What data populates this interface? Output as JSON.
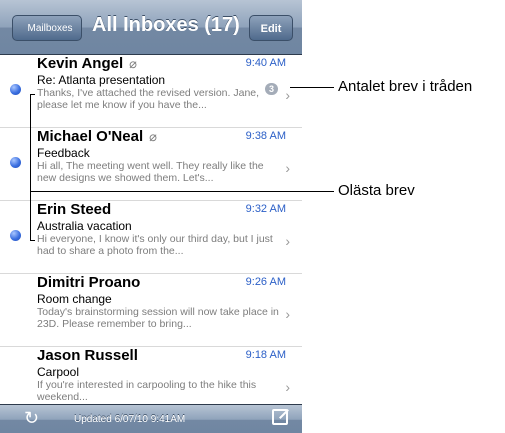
{
  "navbar": {
    "back_label": "Mailboxes",
    "title": "All Inboxes (17)",
    "edit_label": "Edit"
  },
  "messages": [
    {
      "sender": "Kevin Angel",
      "attachment": true,
      "time": "9:40 AM",
      "subject": "Re: Atlanta presentation",
      "preview": "Thanks, I've attached the revised version. Jane, please let me know if you have the...",
      "unread": true,
      "thread_count": "3"
    },
    {
      "sender": "Michael O'Neal",
      "attachment": true,
      "time": "9:38 AM",
      "subject": "Feedback",
      "preview": "Hi all, The meeting went well. They really like the new designs we showed them. Let's...",
      "unread": true
    },
    {
      "sender": "Erin Steed",
      "attachment": false,
      "time": "9:32 AM",
      "subject": "Australia vacation",
      "preview": "Hi everyone, I know it's only our third day, but I just had to share a photo from the...",
      "unread": true
    },
    {
      "sender": "Dimitri Proano",
      "attachment": false,
      "time": "9:26 AM",
      "subject": "Room change",
      "preview": "Today's brainstorming session will now take place in 23D. Please remember to bring...",
      "unread": false
    },
    {
      "sender": "Jason Russell",
      "attachment": false,
      "time": "9:18 AM",
      "subject": "Carpool",
      "preview": "If you're interested in carpooling to the hike this weekend...",
      "unread": false
    }
  ],
  "icons": {
    "attachment": "paperclip-icon",
    "disclosure": "chevron-right-icon",
    "refresh": "refresh-icon",
    "compose": "compose-icon",
    "unread": "blue-dot-icon"
  },
  "toolbar": {
    "updated_text": "Updated 6/07/10 9:41AM"
  },
  "callouts": {
    "thread_count_label": "Antalet brev i tråden",
    "unread_label": "Olästa brev"
  },
  "colors": {
    "unread_dot": "#3b6fe0",
    "time": "#2b5fc7",
    "nav_bar": "#7388a3"
  }
}
